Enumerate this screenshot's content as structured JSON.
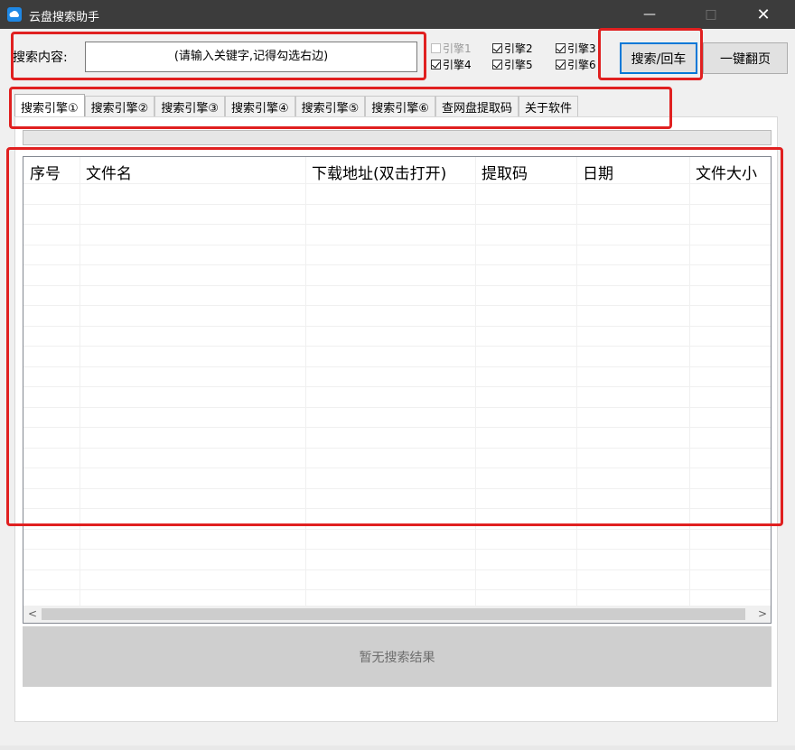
{
  "window": {
    "title": "云盘搜索助手",
    "minimize": "—",
    "maximize": "□",
    "close": "✕"
  },
  "search": {
    "label": "搜索内容:",
    "placeholder": "(请输入关键字,记得勾选右边)"
  },
  "engines": [
    {
      "label": "引擎1",
      "checked": false,
      "enabled": false
    },
    {
      "label": "引擎2",
      "checked": true,
      "enabled": true
    },
    {
      "label": "引擎3",
      "checked": true,
      "enabled": true
    },
    {
      "label": "引擎4",
      "checked": true,
      "enabled": true
    },
    {
      "label": "引擎5",
      "checked": true,
      "enabled": true
    },
    {
      "label": "引擎6",
      "checked": true,
      "enabled": true
    }
  ],
  "buttons": {
    "search": "搜索/回车",
    "next_page": "一键翻页"
  },
  "tabs": [
    "搜索引擎①",
    "搜索引擎②",
    "搜索引擎③",
    "搜索引擎④",
    "搜索引擎⑤",
    "搜索引擎⑥",
    "查网盘提取码",
    "关于软件"
  ],
  "table": {
    "columns": [
      "序号",
      "文件名",
      "下载地址(双击打开)",
      "提取码",
      "日期",
      "文件大小"
    ],
    "rows": []
  },
  "scroll": {
    "left": "<",
    "right": ">"
  },
  "status_text": "暂无搜索结果",
  "colors": {
    "highlight": "#e02020",
    "focus": "#0078d7",
    "titlebar": "#3c3c3c"
  }
}
